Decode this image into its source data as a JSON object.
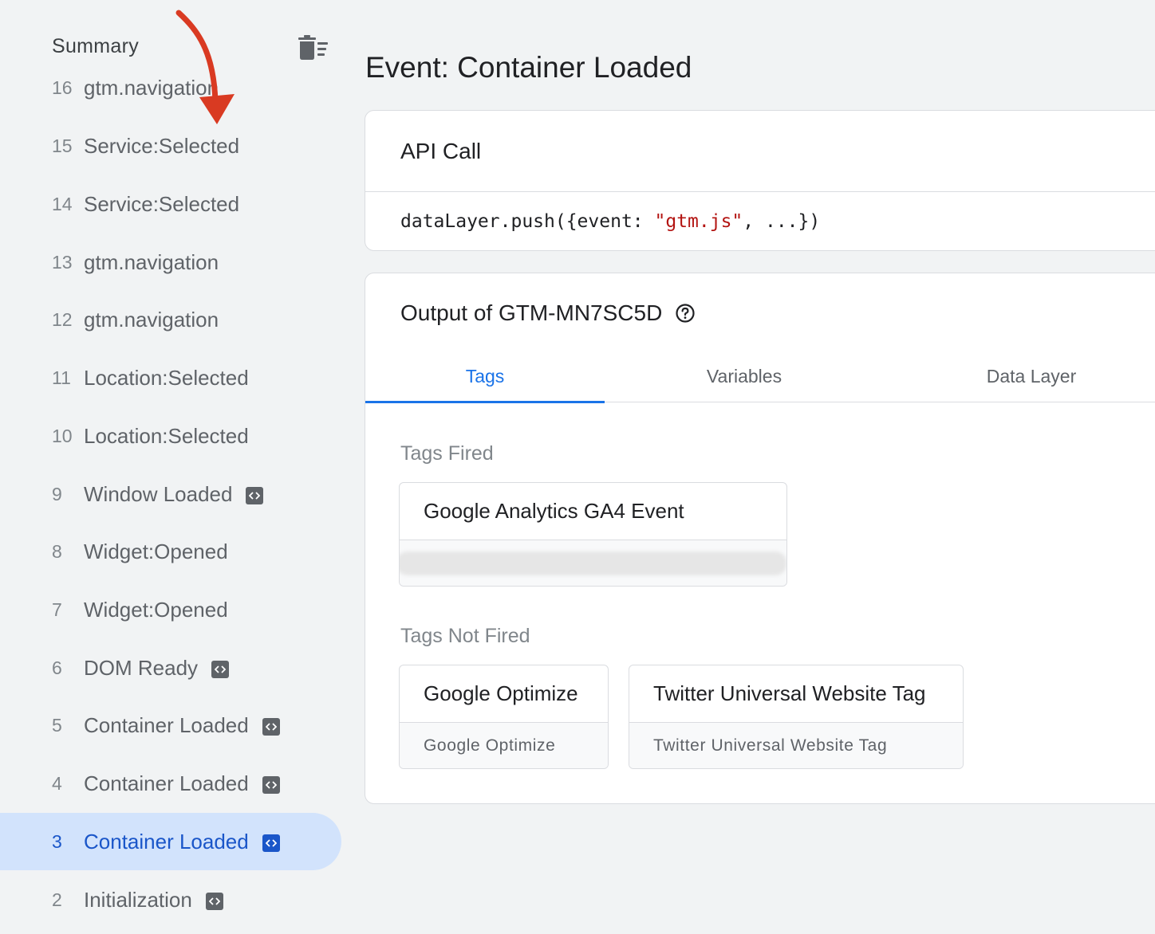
{
  "sidebar": {
    "title": "Summary",
    "clear_icon": "delete-sweep-icon",
    "events": [
      {
        "num": "16",
        "name": "gtm.navigation",
        "has_code_badge": false
      },
      {
        "num": "15",
        "name": "Service:Selected",
        "has_code_badge": false
      },
      {
        "num": "14",
        "name": "Service:Selected",
        "has_code_badge": false
      },
      {
        "num": "13",
        "name": "gtm.navigation",
        "has_code_badge": false
      },
      {
        "num": "12",
        "name": "gtm.navigation",
        "has_code_badge": false
      },
      {
        "num": "11",
        "name": "Location:Selected",
        "has_code_badge": false
      },
      {
        "num": "10",
        "name": "Location:Selected",
        "has_code_badge": false
      },
      {
        "num": "9",
        "name": "Window Loaded",
        "has_code_badge": true
      },
      {
        "num": "8",
        "name": "Widget:Opened",
        "has_code_badge": false
      },
      {
        "num": "7",
        "name": "Widget:Opened",
        "has_code_badge": false
      },
      {
        "num": "6",
        "name": "DOM Ready",
        "has_code_badge": true
      },
      {
        "num": "5",
        "name": "Container Loaded",
        "has_code_badge": true
      },
      {
        "num": "4",
        "name": "Container Loaded",
        "has_code_badge": true
      },
      {
        "num": "3",
        "name": "Container Loaded",
        "has_code_badge": true,
        "selected": true
      },
      {
        "num": "2",
        "name": "Initialization",
        "has_code_badge": true
      }
    ]
  },
  "main": {
    "title": "Event: Container Loaded",
    "api_call": {
      "heading": "API Call",
      "code_prefix": "dataLayer.push({event: ",
      "code_string": "\"gtm.js\"",
      "code_suffix": ", ...})"
    },
    "output": {
      "heading": "Output of GTM-MN7SC5D",
      "help_icon": "help-circle-icon",
      "tabs": [
        {
          "label": "Tags",
          "active": true
        },
        {
          "label": "Variables",
          "active": false
        },
        {
          "label": "Data Layer",
          "active": false
        }
      ],
      "tags_fired": {
        "label": "Tags Fired",
        "items": [
          {
            "title": "Google Analytics GA4 Event",
            "subtitle_redacted": true
          }
        ]
      },
      "tags_not_fired": {
        "label": "Tags Not Fired",
        "items": [
          {
            "title": "Google Optimize",
            "subtitle": "Google Optimize"
          },
          {
            "title": "Twitter Universal Website Tag",
            "subtitle": "Twitter Universal Website Tag"
          }
        ]
      }
    }
  },
  "colors": {
    "accent": "#1a73e8",
    "selected_bg": "#d2e3fc",
    "annotation_arrow": "#d93a22",
    "code_string": "#b31412"
  }
}
